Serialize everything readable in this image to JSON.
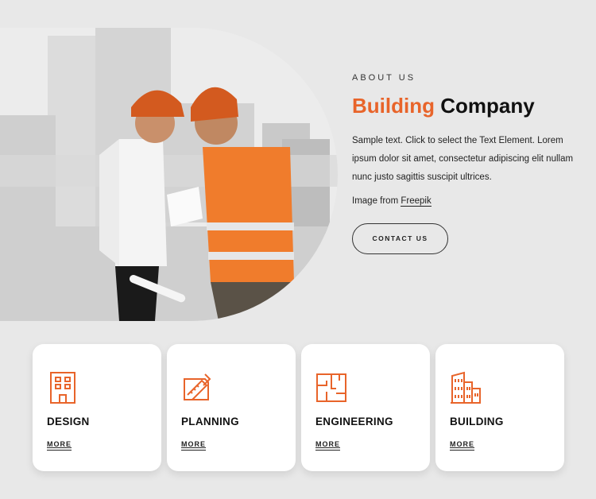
{
  "about": {
    "eyebrow": "ABOUT US",
    "title_accent": "Building",
    "title_rest": "Company",
    "description": "Sample text. Click to select the Text Element. Lorem ipsum dolor sit amet, consectetur adipiscing elit nullam nunc justo sagittis suscipit ultrices.",
    "credit_prefix": "Image from",
    "credit_link": "Freepik",
    "contact_label": "CONTACT US"
  },
  "colors": {
    "accent": "#e8642a",
    "background": "#e8e8e8",
    "card": "#ffffff"
  },
  "cards": [
    {
      "icon": "office-building-icon",
      "label": "DESIGN",
      "more": "MORE"
    },
    {
      "icon": "blueprint-ruler-icon",
      "label": "PLANNING",
      "more": "MORE"
    },
    {
      "icon": "floor-plan-icon",
      "label": "ENGINEERING",
      "more": "MORE"
    },
    {
      "icon": "city-buildings-icon",
      "label": "BUILDING",
      "more": "MORE"
    }
  ]
}
